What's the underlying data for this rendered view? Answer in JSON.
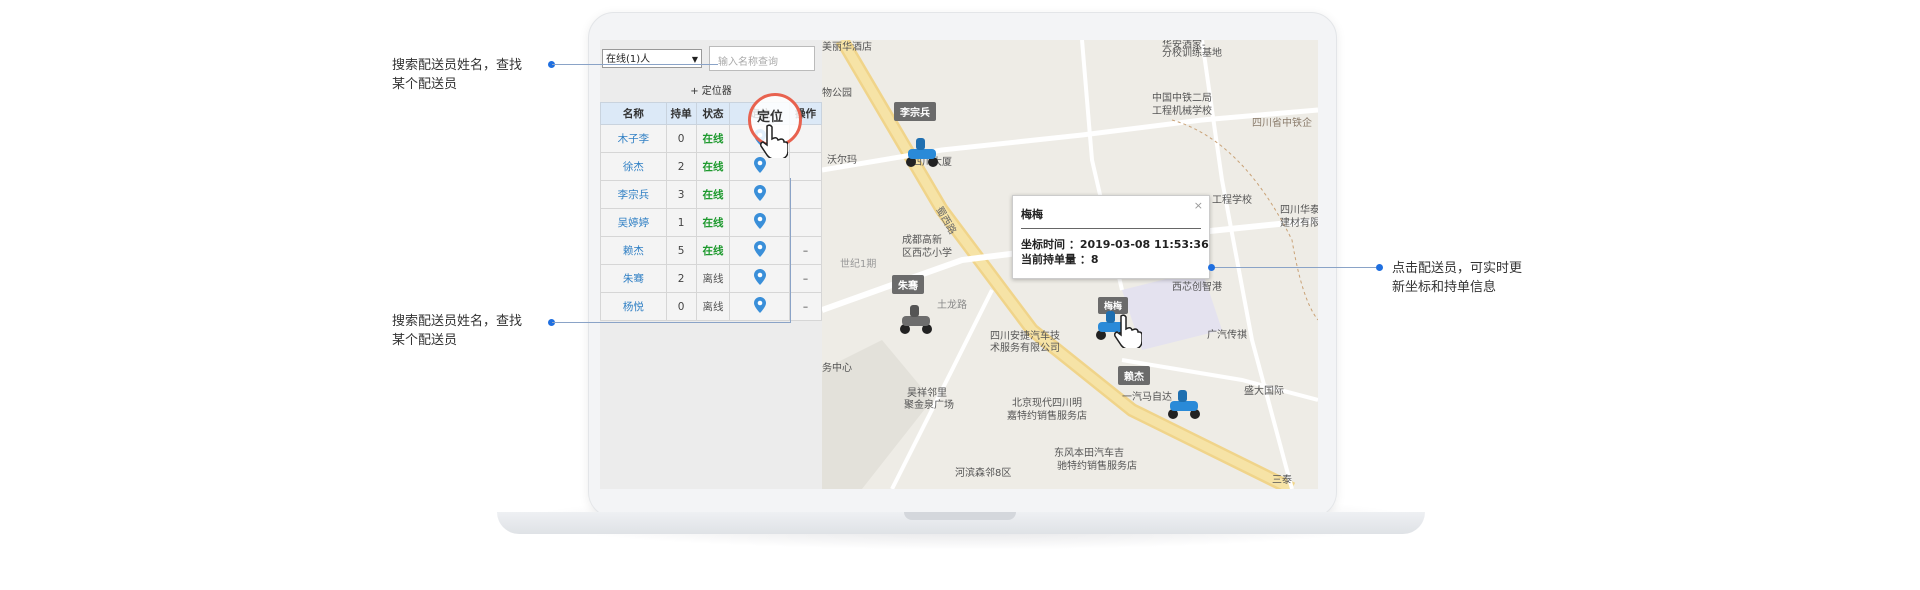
{
  "annotations": {
    "note_top_left": [
      "搜索配送员姓名，查找",
      "某个配送员"
    ],
    "note_bottom_left": [
      "搜索配送员姓名，查找",
      "某个配送员"
    ],
    "note_right": [
      "点击配送员，可实时更",
      "新坐标和持单信息"
    ]
  },
  "panel": {
    "status_select": "在线(1)人",
    "search_placeholder": "输入名称查询",
    "locator_button": "+ 定位器",
    "columns": [
      "名称",
      "持单",
      "状态",
      "定位",
      "操作"
    ],
    "loc_header_highlight": "定位",
    "rows": [
      {
        "name": "木子李",
        "orders": "0",
        "status": "在线",
        "status_type": "online",
        "action": ""
      },
      {
        "name": "徐杰",
        "orders": "2",
        "status": "在线",
        "status_type": "online",
        "action": ""
      },
      {
        "name": "李宗兵",
        "orders": "3",
        "status": "在线",
        "status_type": "online",
        "action": ""
      },
      {
        "name": "吴婷婷",
        "orders": "1",
        "status": "在线",
        "status_type": "online",
        "action": ""
      },
      {
        "name": "赖杰",
        "orders": "5",
        "status": "在线",
        "status_type": "online",
        "action": "–"
      },
      {
        "name": "朱骞",
        "orders": "2",
        "status": "离线",
        "status_type": "offline",
        "action": "–"
      },
      {
        "name": "杨悦",
        "orders": "0",
        "status": "离线",
        "status_type": "offline",
        "action": "–"
      }
    ]
  },
  "map": {
    "labels": [
      "美丽华酒店",
      "华安酒家-",
      "分校训练基地",
      "中国中铁二局",
      "工程机械学校",
      "四川省中铁企",
      "物公园",
      "沃尔玛",
      "四川大厦",
      "工程学校",
      "四川华泰",
      "建材有限",
      "成都高新",
      "区西芯小学",
      "世纪1期",
      "土龙路",
      "西芯创智港",
      "广汽传祺",
      "四川安捷汽车技",
      "术服务有限公司",
      "务中心",
      "昊祥邻里",
      "聚金泉广场",
      "北京现代四川明",
      "嘉特约销售服务店",
      "一汽马自达",
      "盛大国际",
      "东风本田汽车吉",
      "驰特约销售服务店",
      "河滨森邻8区",
      "三泰",
      "蜀西路"
    ],
    "riders": [
      "李宗兵",
      "朱骞",
      "赖杰",
      "梅梅"
    ],
    "popup": {
      "title": "梅梅",
      "line1": "坐标时间 ：2019-03-08 11:53:36",
      "line2": "当前持单量 ：8",
      "close": "×"
    }
  },
  "colors": {
    "accent_blue": "#2f7fc4",
    "online_green": "#1f9a2f",
    "highlight_red": "#e8624f",
    "road_yellow": "#f2d98c",
    "annotation_dot": "#1f6fe0"
  }
}
